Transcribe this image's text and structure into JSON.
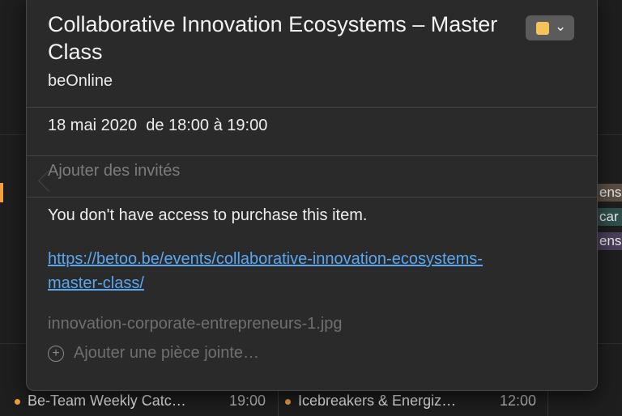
{
  "popover": {
    "title": "Collaborative Innovation Ecosystems – Master Class",
    "location": "beOnline",
    "color_chip": "#f6c35b",
    "date_time": "18 mai 2020  de 18:00 à 19:00",
    "invitees_placeholder": "Ajouter des invités",
    "notes": "You don't have access to purchase this item.",
    "url": "https://betoo.be/events/collaborative-innovation-ecosystems-master-class/",
    "attachment_name": "innovation-corporate-entrepreneurs-1.jpg",
    "add_attachment_label": "Ajouter une pièce jointe…"
  },
  "background": {
    "side_chips": [
      "ens",
      "car",
      "ens"
    ],
    "events": [
      {
        "title": "Be-Team Weekly Catc…",
        "time": "19:00"
      },
      {
        "title": "Icebreakers & Energiz…",
        "time": "12:00"
      }
    ]
  }
}
